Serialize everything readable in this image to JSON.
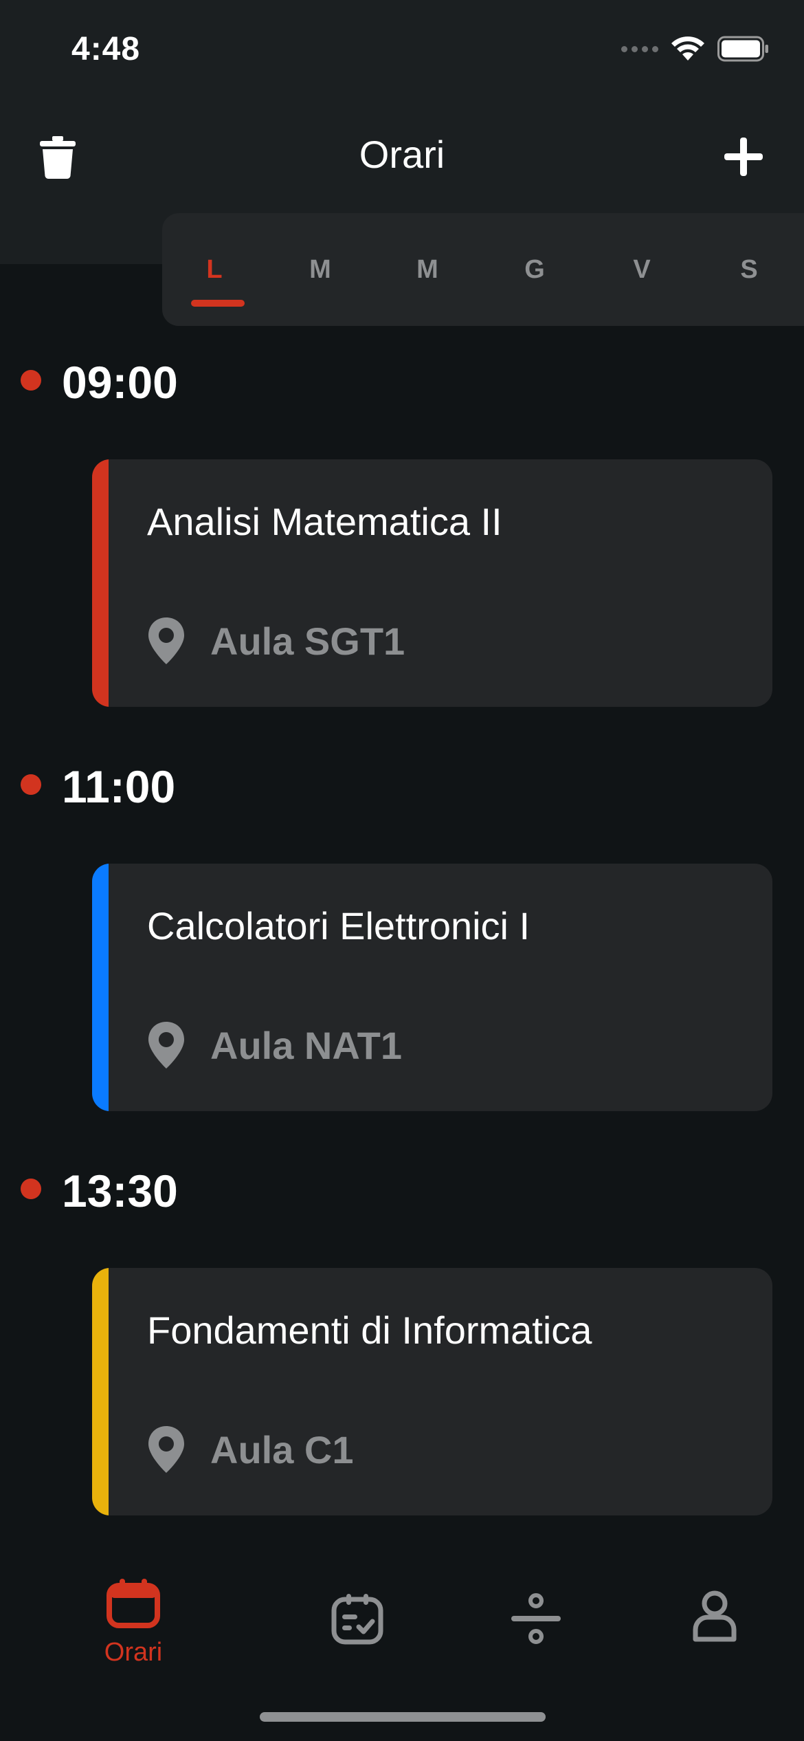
{
  "status_bar": {
    "time": "4:48",
    "icons": [
      "cellular-signal-icon",
      "wifi-icon",
      "battery-icon"
    ]
  },
  "nav": {
    "title": "Orari",
    "left_icon": "trash-icon",
    "right_icon": "plus-icon"
  },
  "days": [
    {
      "label": "L",
      "active": true
    },
    {
      "label": "M",
      "active": false
    },
    {
      "label": "M",
      "active": false
    },
    {
      "label": "G",
      "active": false
    },
    {
      "label": "V",
      "active": false
    },
    {
      "label": "S",
      "active": false
    }
  ],
  "schedule": [
    {
      "time": "09:00",
      "course": "Analisi Matematica II",
      "room": "Aula SGT1",
      "color": "#d2341f"
    },
    {
      "time": "11:00",
      "course": "Calcolatori Elettronici I",
      "room": "Aula NAT1",
      "color": "#0a7bff"
    },
    {
      "time": "13:30",
      "course": "Fondamenti di Informatica",
      "room": "Aula C1",
      "color": "#e9b20c"
    }
  ],
  "tab_bar": {
    "tabs": [
      {
        "label": "Orari",
        "icon": "calendar-icon",
        "active": true
      },
      {
        "label": "",
        "icon": "exam-clipboard-icon",
        "active": false
      },
      {
        "label": "",
        "icon": "divide-icon",
        "active": false
      },
      {
        "label": "",
        "icon": "profile-icon",
        "active": false
      }
    ]
  },
  "colors": {
    "accent": "#d2341f",
    "background": "#101416",
    "card": "#242628",
    "inactive": "#8e9092"
  }
}
